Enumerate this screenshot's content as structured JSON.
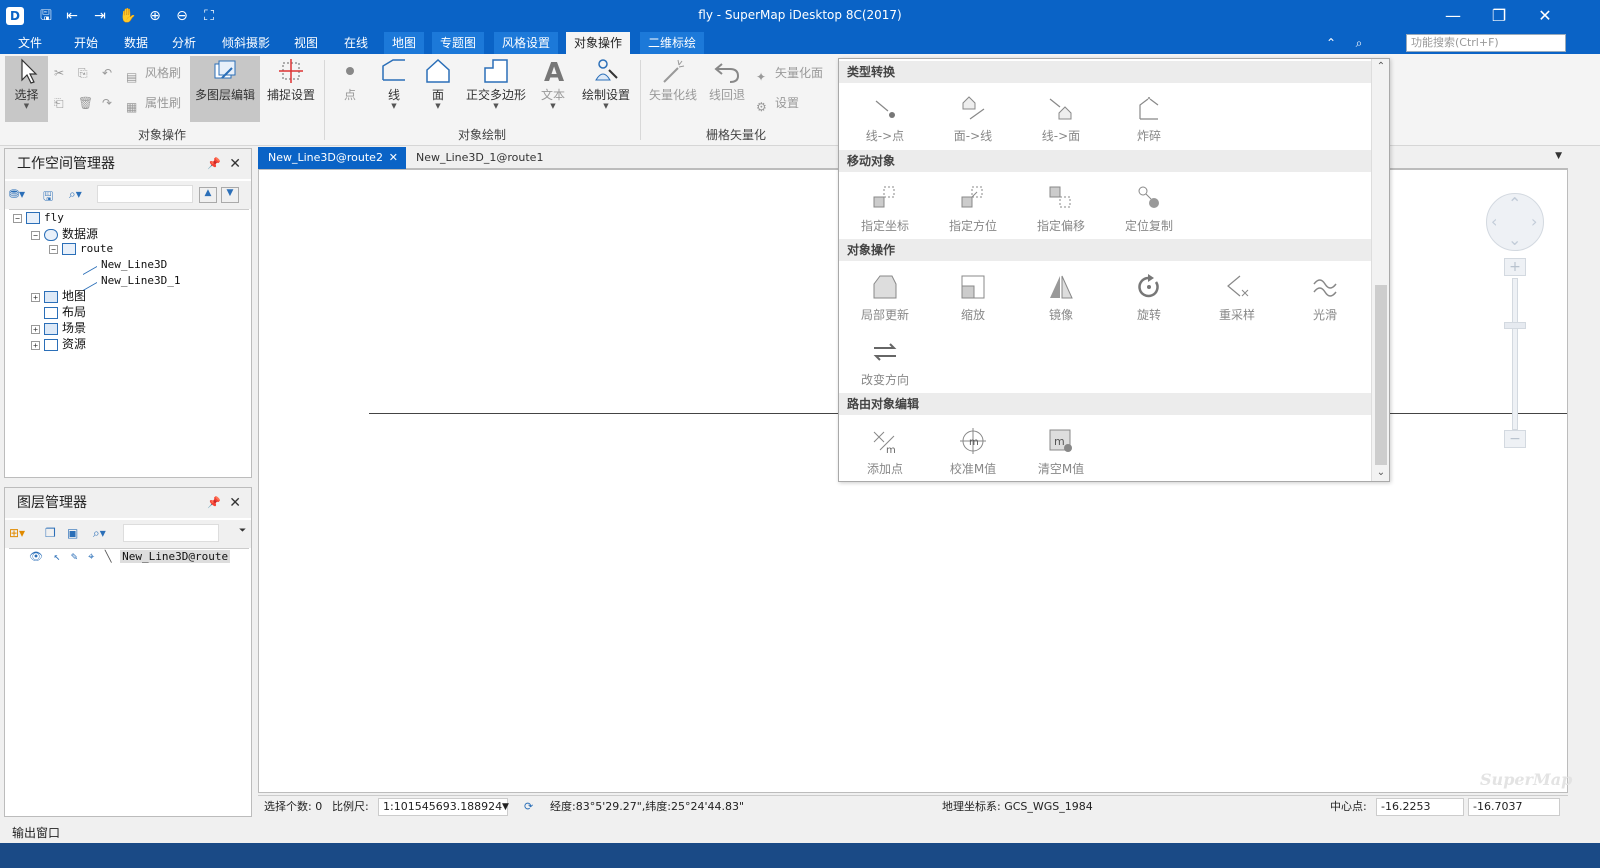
{
  "app": {
    "title": "fly - SuperMap iDesktop 8C(2017)"
  },
  "menu": {
    "tabs": [
      "文件",
      "开始",
      "数据",
      "分析",
      "倾斜摄影",
      "视图",
      "在线",
      "地图",
      "专题图",
      "风格设置",
      "对象操作",
      "二维标绘"
    ],
    "active_tab": "对象操作",
    "search_placeholder": "功能搜索(Ctrl+F)"
  },
  "ribbon": {
    "select": "选择",
    "style_brush": "风格刷",
    "attr_brush": "属性刷",
    "multi_layer_edit": "多图层编辑",
    "snap_settings": "捕捉设置",
    "group_object_ops": "对象操作",
    "point": "点",
    "line": "线",
    "face": "面",
    "ortho_polygon": "正交多边形",
    "text": "文本",
    "draw_settings": "绘制设置",
    "group_object_draw": "对象绘制",
    "vectorize_line": "矢量化线",
    "line_back": "线回退",
    "vectorize_face": "矢量化面",
    "settings": "设置",
    "group_raster_vectorize": "栅格矢量化"
  },
  "gallery": {
    "sections": {
      "type_convert": "类型转换",
      "move_objects": "移动对象",
      "object_ops": "对象操作",
      "route_edit": "路由对象编辑"
    },
    "type_convert": [
      "线->点",
      "面->线",
      "线->面",
      "炸碎"
    ],
    "move_objects": [
      "指定坐标",
      "指定方位",
      "指定偏移",
      "定位复制"
    ],
    "object_ops": [
      "局部更新",
      "缩放",
      "镜像",
      "旋转",
      "重采样",
      "光滑",
      "改变方向"
    ],
    "route_edit": [
      "添加点",
      "校准M值",
      "清空M值"
    ]
  },
  "workspace": {
    "title": "工作空间管理器",
    "root": "fly",
    "datasources": "数据源",
    "route": "route",
    "datasets": [
      "New_Line3D",
      "New_Line3D_1"
    ],
    "maps": "地图",
    "layouts": "布局",
    "scenes": "场景",
    "resources": "资源"
  },
  "layers": {
    "title": "图层管理器",
    "layer_name": "New_Line3D@route"
  },
  "doc_tabs": [
    "New_Line3D@route2",
    "New_Line3D_1@route1"
  ],
  "status": {
    "selected_label": "选择个数: 0",
    "scale_label": "比例尺:",
    "scale_value": "1:101545693.188924",
    "lonlat": "经度:83°5'29.27\",纬度:25°24'44.83\"",
    "crs": "地理坐标系: GCS_WGS_1984",
    "center_label": "中心点:",
    "center_x": "-16.2253",
    "center_y": "-16.7037"
  },
  "output_window": "输出窗口",
  "watermark": "SuperMap"
}
